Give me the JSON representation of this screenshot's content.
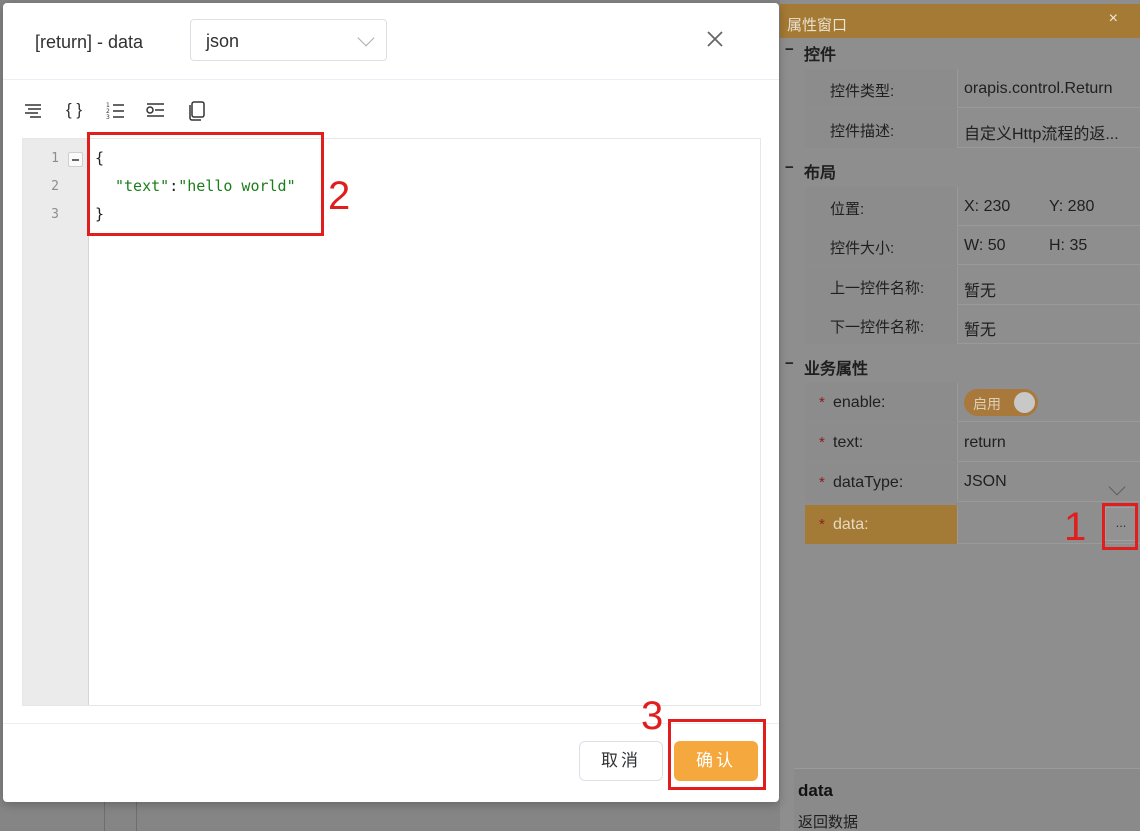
{
  "props_panel": {
    "title": "属性窗口",
    "close_glyph": "×",
    "sections": [
      {
        "label": "控件",
        "toggle": "−"
      },
      {
        "label": "布局",
        "toggle": "−"
      },
      {
        "label": "业务属性",
        "toggle": "−"
      }
    ],
    "control_rows": [
      {
        "key": "控件类型:",
        "value": "orapis.control.Return"
      },
      {
        "key": "控件描述:",
        "value": "自定义Http流程的返..."
      }
    ],
    "layout_rows": [
      {
        "key": "位置:",
        "value": "X: 230",
        "value2": "Y: 280"
      },
      {
        "key": "控件大小:",
        "value": "W: 50",
        "value2": "H: 35"
      },
      {
        "key": "上一控件名称:",
        "value": "暂无"
      },
      {
        "key": "下一控件名称:",
        "value": "暂无"
      }
    ],
    "business_rows": {
      "required_mark": "*",
      "enable_key": "enable:",
      "enable_switch_label": "启用",
      "text_key": "text:",
      "text_value": "return",
      "datatype_key": "dataType:",
      "datatype_value": "JSON",
      "data_key": "data:",
      "data_button": "..."
    },
    "description": {
      "title": "data",
      "text": "返回数据"
    }
  },
  "dialog": {
    "title": "[return] - data",
    "format_select": "json",
    "toolbar_icons": [
      "format-icon",
      "braces-icon",
      "numbered-list-icon",
      "indent-icon",
      "copy-icon"
    ],
    "braces_glyph": "{ }",
    "editor": {
      "line_numbers": [
        "1",
        "2",
        "3"
      ],
      "lines": {
        "l1": "{",
        "l2_key": "\"text\"",
        "l2_colon": ":",
        "l2_value": "\"hello world\"",
        "l3": "}"
      }
    },
    "cancel_label": "取消",
    "confirm_label": "确认"
  },
  "annotations": [
    "1",
    "2",
    "3"
  ],
  "colors": {
    "accent": "#f5a83e",
    "titlebar_dimmed": "#a47a34",
    "annotation_red": "#e01e1e",
    "json_string": "#1a7f1a"
  }
}
